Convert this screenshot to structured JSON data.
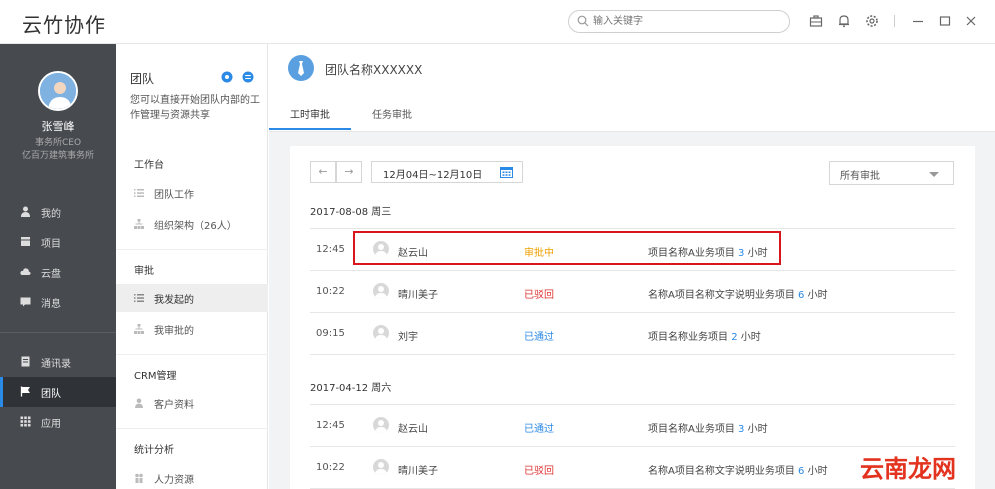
{
  "app": {
    "title": "云竹协作"
  },
  "search": {
    "placeholder": "输入关键字"
  },
  "top_icons": [
    "briefcase-icon",
    "bell-icon",
    "gear-icon",
    "minimize-icon",
    "maximize-icon",
    "close-icon"
  ],
  "user": {
    "name": "张雪峰",
    "title": "事务所CEO",
    "org": "亿百万建筑事务所"
  },
  "nav": {
    "items": [
      {
        "label": "我的",
        "icon": "person-icon"
      },
      {
        "label": "项目",
        "icon": "project-icon"
      },
      {
        "label": "云盘",
        "icon": "cloud-icon"
      },
      {
        "label": "消息",
        "icon": "message-icon"
      },
      {
        "label": "通讯录",
        "icon": "contacts-icon"
      },
      {
        "label": "团队",
        "icon": "flag-icon"
      },
      {
        "label": "应用",
        "icon": "apps-icon"
      }
    ],
    "active": "团队"
  },
  "team_panel": {
    "heading": "团队",
    "description": "您可以直接开始团队内部的工作管理与资源共享",
    "sections": [
      {
        "title": "工作台",
        "items": [
          "团队工作",
          "组织架构（26人）"
        ]
      },
      {
        "title": "审批",
        "items": [
          "我发起的",
          "我审批的"
        ]
      },
      {
        "title": "CRM管理",
        "items": [
          "客户资料"
        ]
      },
      {
        "title": "统计分析",
        "items": [
          "人力资源"
        ]
      }
    ],
    "active_item": "我发起的"
  },
  "main": {
    "team_name": "团队名称XXXXXX",
    "tabs": [
      "工时审批",
      "任务审批"
    ],
    "active_tab": "工时审批",
    "prev_label": "←",
    "next_label": "→",
    "date_range": "12月04日~12月10日",
    "filter": "所有审批",
    "groups": [
      {
        "date": "2017-08-08  周三",
        "rows": [
          {
            "time": "12:45",
            "name": "赵云山",
            "status": "审批中",
            "status_type": "pending",
            "desc": "项目名称A业务项目",
            "hours": "3",
            "unit": "小时"
          },
          {
            "time": "10:22",
            "name": "晴川美子",
            "status": "已驳回",
            "status_type": "rejected",
            "desc": "名称A项目名称文字说明业务项目",
            "hours": "6",
            "unit": "小时"
          },
          {
            "time": "09:15",
            "name": "刘宇",
            "status": "已通过",
            "status_type": "passed",
            "desc": "项目名称业务项目",
            "hours": "2",
            "unit": "小时"
          }
        ]
      },
      {
        "date": "2017-04-12  周六",
        "rows": [
          {
            "time": "12:45",
            "name": "赵云山",
            "status": "已通过",
            "status_type": "passed",
            "desc": "项目名称A业务项目",
            "hours": "3",
            "unit": "小时"
          },
          {
            "time": "10:22",
            "name": "晴川美子",
            "status": "已驳回",
            "status_type": "rejected",
            "desc": "名称A项目名称文字说明业务项目",
            "hours": "6",
            "unit": "小时"
          }
        ]
      }
    ]
  },
  "colors": {
    "accent": "#2b8ae6",
    "pending": "#f0a000",
    "rejected": "#e03333",
    "highlight": "#d9161c",
    "sidebar": "#474a4f"
  },
  "watermark": "云南龙网"
}
